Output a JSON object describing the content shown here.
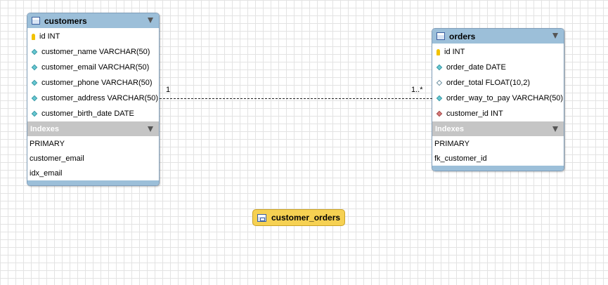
{
  "tables": [
    {
      "name": "customers",
      "columns": [
        {
          "label": "id INT",
          "icon": "primary-key-icon"
        },
        {
          "label": "customer_name VARCHAR(50)",
          "icon": "column-icon"
        },
        {
          "label": "customer_email VARCHAR(50)",
          "icon": "column-icon"
        },
        {
          "label": "customer_phone VARCHAR(50)",
          "icon": "column-icon"
        },
        {
          "label": "customer_address VARCHAR(50)",
          "icon": "column-icon"
        },
        {
          "label": "customer_birth_date DATE",
          "icon": "column-icon"
        }
      ],
      "indexes_title": "Indexes",
      "indexes": [
        "PRIMARY",
        "customer_email",
        "idx_email"
      ]
    },
    {
      "name": "orders",
      "columns": [
        {
          "label": "id INT",
          "icon": "primary-key-icon"
        },
        {
          "label": "order_date DATE",
          "icon": "column-icon"
        },
        {
          "label": "order_total FLOAT(10,2)",
          "icon": "nullable-column-icon"
        },
        {
          "label": "order_way_to_pay VARCHAR(50)",
          "icon": "column-icon"
        },
        {
          "label": "customer_id INT",
          "icon": "foreign-key-icon"
        }
      ],
      "indexes_title": "Indexes",
      "indexes": [
        "PRIMARY",
        "fk_customer_id"
      ]
    }
  ],
  "relationship": {
    "from_cardinality": "1",
    "to_cardinality": "1..*"
  },
  "view": {
    "name": "customer_orders",
    "icon": "view-icon"
  },
  "colors": {
    "table_header": "#9cbfd9",
    "index_header": "#c5c5c5",
    "view_background": "#f6d152"
  }
}
